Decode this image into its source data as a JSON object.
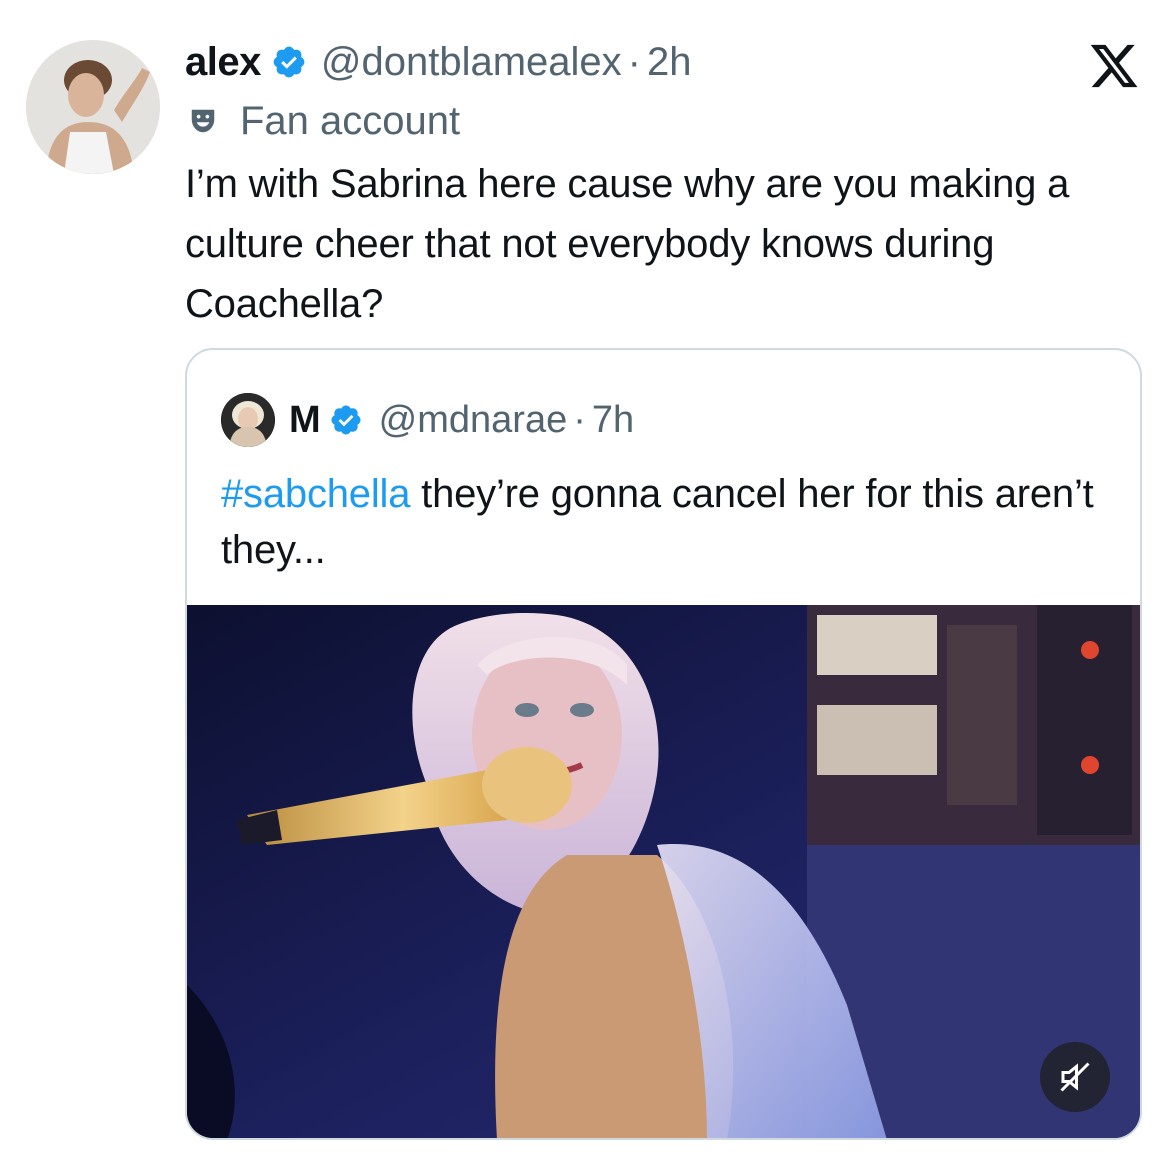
{
  "author": {
    "name": "alex",
    "handle": "@dontblamealex",
    "separator": "·",
    "time": "2h",
    "label": "Fan account",
    "verified": true
  },
  "tweet": {
    "text": "I’m with Sabrina here cause why are you making a culture cheer that not everybody knows during Coachella?"
  },
  "quoted": {
    "name": "M",
    "handle": "@mdnarae",
    "separator": "·",
    "time": "7h",
    "hashtag": "#sabchella",
    "text_rest": " they’re gonna cancel her for this aren’t they...",
    "verified": true
  },
  "media": {
    "mute_icon": "speaker-muted-icon"
  },
  "colors": {
    "accent": "#1d9bf0",
    "secondary_text": "#536471",
    "border": "#cfd9de"
  }
}
